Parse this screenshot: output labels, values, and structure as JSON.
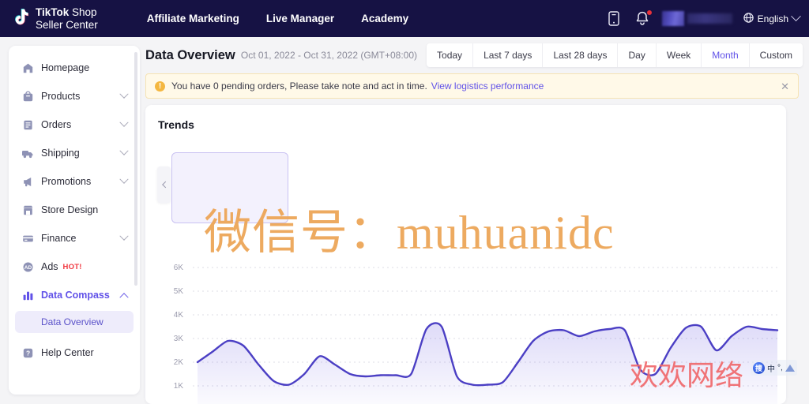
{
  "topnav": {
    "brand": {
      "line1_bold": "TikTok",
      "line1_rest": " Shop",
      "line2": "Seller Center",
      "logo_icon": "tiktok-note-icon"
    },
    "links": [
      {
        "label": "Affiliate Marketing"
      },
      {
        "label": "Live Manager"
      },
      {
        "label": "Academy"
      }
    ],
    "mobile_icon": "mobile-phone-icon",
    "bell_icon": "bell-icon",
    "language": {
      "label": "English",
      "globe_icon": "globe-icon",
      "chevron_icon": "chevron-down-icon"
    }
  },
  "sidebar": {
    "items": [
      {
        "label": "Homepage",
        "icon": "home-icon",
        "expandable": false,
        "active": false
      },
      {
        "label": "Products",
        "icon": "bag-icon",
        "expandable": true,
        "active": false
      },
      {
        "label": "Orders",
        "icon": "clipboard-icon",
        "expandable": true,
        "active": false
      },
      {
        "label": "Shipping",
        "icon": "truck-icon",
        "expandable": true,
        "active": false
      },
      {
        "label": "Promotions",
        "icon": "megaphone-icon",
        "expandable": true,
        "active": false
      },
      {
        "label": "Store Design",
        "icon": "storefront-icon",
        "expandable": false,
        "active": false
      },
      {
        "label": "Finance",
        "icon": "card-icon",
        "expandable": true,
        "active": false
      },
      {
        "label": "Ads",
        "icon": "ads-icon",
        "expandable": false,
        "active": false,
        "tag": "HOT!"
      },
      {
        "label": "Data Compass",
        "icon": "bar-chart-icon",
        "expandable": true,
        "active": true,
        "expanded": true
      },
      {
        "label": "Help Center",
        "icon": "help-icon",
        "expandable": false,
        "active": false
      }
    ],
    "sub_item": {
      "label": "Data Overview",
      "selected": true
    }
  },
  "main": {
    "page_title": "Data Overview",
    "date_range": "Oct 01, 2022 - Oct 31, 2022 (GMT+08:00)",
    "range_tabs": [
      {
        "label": "Today",
        "selected": false
      },
      {
        "label": "Last 7 days",
        "selected": false
      },
      {
        "label": "Last 28 days",
        "selected": false
      },
      {
        "label": "Day",
        "selected": false
      },
      {
        "label": "Week",
        "selected": false
      },
      {
        "label": "Month",
        "selected": true
      },
      {
        "label": "Custom",
        "selected": false
      }
    ],
    "alert": {
      "icon": "warning-icon",
      "text": "You have 0 pending orders, Please take note and act in time.",
      "link_text": "View logistics performance",
      "close_icon": "close-icon"
    },
    "panel": {
      "title": "Trends",
      "prev_icon": "chevron-left-icon"
    }
  },
  "chart_data": {
    "type": "line",
    "title": "Trends",
    "xlabel": "",
    "ylabel": "",
    "ylim": [
      0,
      6500
    ],
    "ytick_labels": [
      "1K",
      "2K",
      "3K",
      "4K",
      "5K",
      "6K"
    ],
    "ytick_values": [
      1000,
      2000,
      3000,
      4000,
      5000,
      6000
    ],
    "grid": true,
    "legend_position": "none",
    "line_color": "#4b3fc4",
    "fill_color": "#6a5be0",
    "series": [
      {
        "name": "Trend",
        "values": [
          2000,
          2450,
          2900,
          2700,
          1900,
          1200,
          1050,
          1500,
          2250,
          1900,
          1500,
          1400,
          1450,
          1450,
          1500,
          3400,
          3500,
          1400,
          1050,
          1050,
          1150,
          2000,
          2900,
          3300,
          3350,
          3100,
          3300,
          3400,
          3350,
          1700,
          1500,
          2600,
          3450,
          3500,
          2500,
          3100,
          3500,
          3400,
          3350
        ]
      }
    ]
  },
  "watermarks": {
    "wechat": "微信号：muhuanidc",
    "site": "欢欢网络",
    "ime_logo": "搜",
    "ime_mode": "中"
  }
}
